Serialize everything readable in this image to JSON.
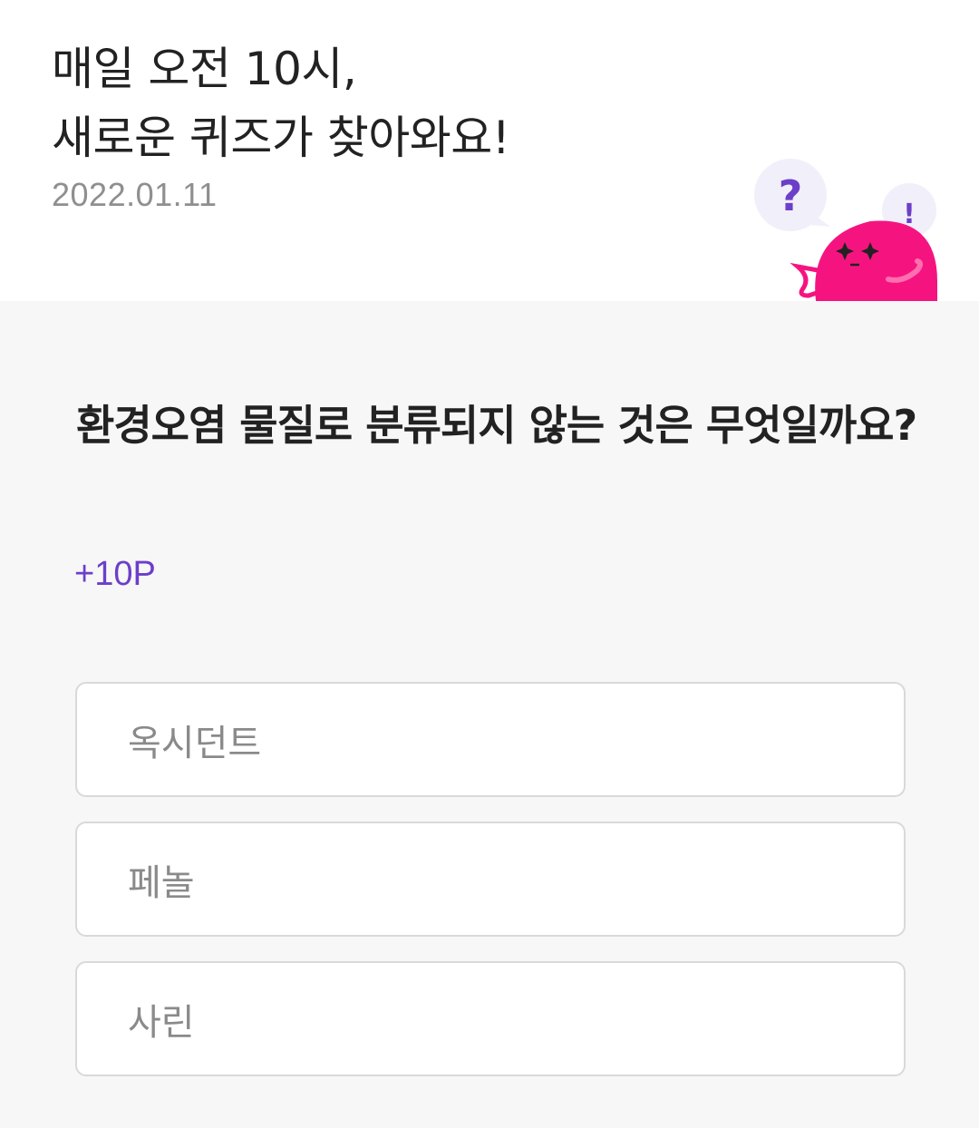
{
  "header": {
    "headline_line1": "매일 오전 10시,",
    "headline_line2": "새로운 퀴즈가 찾아와요!",
    "date": "2022.01.11",
    "mascot": {
      "bubble_question": "?",
      "bubble_exclaim": "!",
      "colors": {
        "body": "#f5147f",
        "bubble": "#f1effa",
        "mark": "#6b3fc9"
      }
    }
  },
  "quiz": {
    "question": "환경오염 물질로 분류되지 않는 것은 무엇일까요?",
    "points": "+10P",
    "options": [
      {
        "label": "옥시던트"
      },
      {
        "label": "페놀"
      },
      {
        "label": "사린"
      }
    ]
  },
  "colors": {
    "accent": "#6b3fc9",
    "background": "#f7f7f7",
    "border": "#d9d9d9"
  }
}
